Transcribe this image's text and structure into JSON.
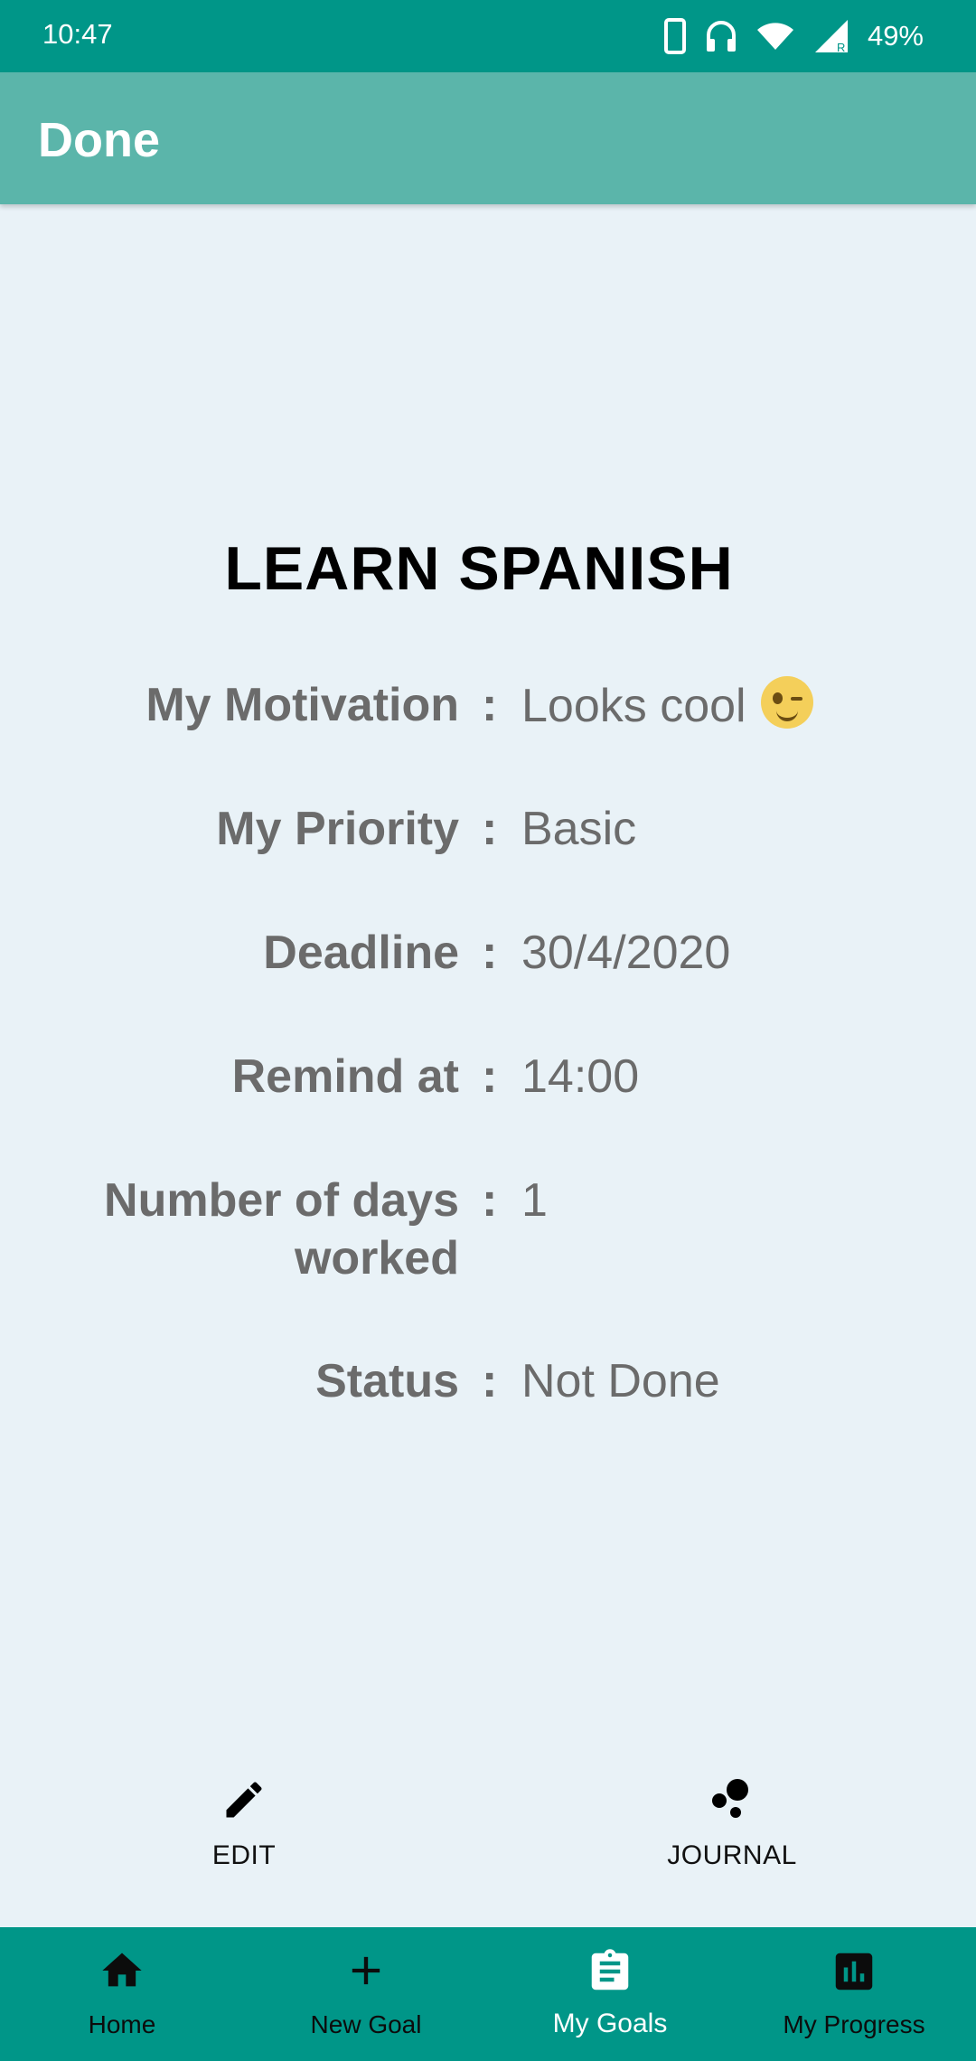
{
  "status_bar": {
    "time": "10:47",
    "battery": "49%"
  },
  "app_bar": {
    "title": "Done"
  },
  "goal": {
    "title": "LEARN SPANISH",
    "fields": [
      {
        "label": "My Motivation",
        "value": "Looks cool"
      },
      {
        "label": "My Priority",
        "value": "Basic"
      },
      {
        "label": "Deadline",
        "value": "30/4/2020"
      },
      {
        "label": "Remind at",
        "value": "14:00"
      },
      {
        "label": "Number of days worked",
        "value": "1"
      },
      {
        "label": "Status",
        "value": "Not Done"
      }
    ],
    "separator": ":"
  },
  "actions": {
    "edit_label": "EDIT",
    "journal_label": "JOURNAL"
  },
  "bottom_nav": {
    "items": [
      {
        "label": "Home",
        "icon": "home-icon"
      },
      {
        "label": "New Goal",
        "icon": "plus-icon"
      },
      {
        "label": "My Goals",
        "icon": "clipboard-icon",
        "active": true
      },
      {
        "label": "My Progress",
        "icon": "bar-chart-icon"
      }
    ]
  },
  "colors": {
    "primary": "#009688",
    "app_bar": "#5bb5aa",
    "background": "#e9f2f7",
    "text_muted": "#6b6b6b"
  }
}
